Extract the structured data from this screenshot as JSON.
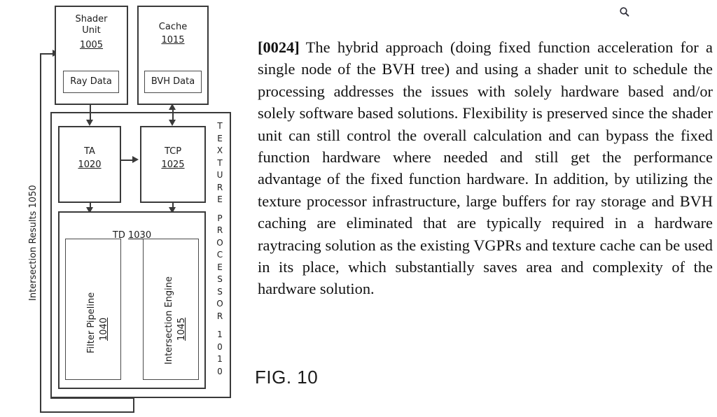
{
  "figure": {
    "caption": "FIG. 10",
    "outer_label": {
      "intersection_results": "Intersection Results 1050"
    },
    "texture_processor": {
      "letters": [
        "T",
        "E",
        "X",
        "T",
        "U",
        "R",
        "E",
        "P",
        "R",
        "O",
        "C",
        "E",
        "S",
        "S",
        "O",
        "R",
        "1",
        "0",
        "1",
        "0"
      ],
      "name": "TEXTURE PROCESSOR",
      "ref": "1010"
    },
    "blocks": {
      "shader_unit": {
        "title": "Shader\nUnit",
        "ref": "1005"
      },
      "ray_data": {
        "label": "Ray Data"
      },
      "cache": {
        "title": "Cache",
        "ref": "1015"
      },
      "bvh_data": {
        "label": "BVH Data"
      },
      "ta": {
        "title": "TA",
        "ref": "1020"
      },
      "tcp": {
        "title": "TCP",
        "ref": "1025"
      },
      "td": {
        "title": "TD",
        "ref": "1030"
      },
      "filter_pipeline": {
        "title": "Filter Pipeline",
        "ref": "1040"
      },
      "intersection_engine": {
        "title": "Intersection Engine",
        "ref": "1045"
      }
    }
  },
  "paragraph": {
    "number": "[0024]",
    "body": "The hybrid approach (doing fixed function acceleration for a single node of the BVH tree) and using a shader unit to schedule the processing addresses the issues with solely hardware based and/or solely software based solutions. Flexibility is preserved since the shader unit can still control the overall calculation and can bypass the fixed function hardware where needed and still get the performance advantage of the fixed function hardware. In addition, by utilizing the texture processor infrastructure, large buffers for ray storage and BVH caching are eliminated that are typically required in a hardware raytracing solution as the existing VGPRs and texture cache can be used in its place, which substantially saves area and complexity of the hardware solution."
  },
  "toolbar": {
    "search_icon": "search-icon"
  },
  "colors": {
    "line": "#3a3a3a",
    "text": "#111111",
    "background": "#ffffff"
  }
}
